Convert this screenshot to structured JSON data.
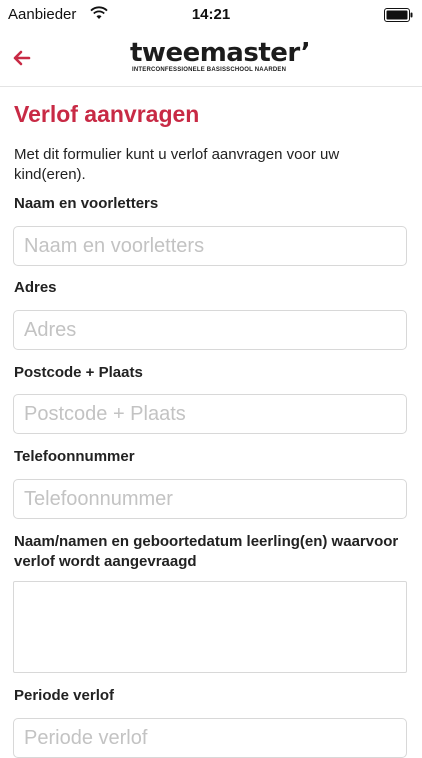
{
  "status_bar": {
    "carrier": "Aanbieder",
    "time": "14:21",
    "wifi_icon": "wifi-icon",
    "battery_icon": "battery-icon"
  },
  "header": {
    "back_icon": "arrow-left-icon",
    "logo_name": "tweemaster’",
    "logo_tagline": "INTERCONFESSIONELE BASISSCHOOL NAARDEN",
    "accent_color": "#c82a45"
  },
  "form": {
    "title": "Verlof aanvragen",
    "intro": "Met dit formulier kunt u verlof aanvragen voor uw kind(eren).",
    "fields": [
      {
        "label": "Naam en voorletters",
        "placeholder": "Naam en voorletters",
        "value": ""
      },
      {
        "label": "Adres",
        "placeholder": "Adres",
        "value": ""
      },
      {
        "label": "Postcode + Plaats",
        "placeholder": "Postcode + Plaats",
        "value": ""
      },
      {
        "label": "Telefoonnummer",
        "placeholder": "Telefoonnummer",
        "value": ""
      },
      {
        "label": "Naam/namen en geboortedatum leerling(en) waarvoor verlof wordt aangevraagd",
        "placeholder": "",
        "value": ""
      },
      {
        "label": "Periode verlof",
        "placeholder": "Periode verlof",
        "value": ""
      }
    ]
  }
}
